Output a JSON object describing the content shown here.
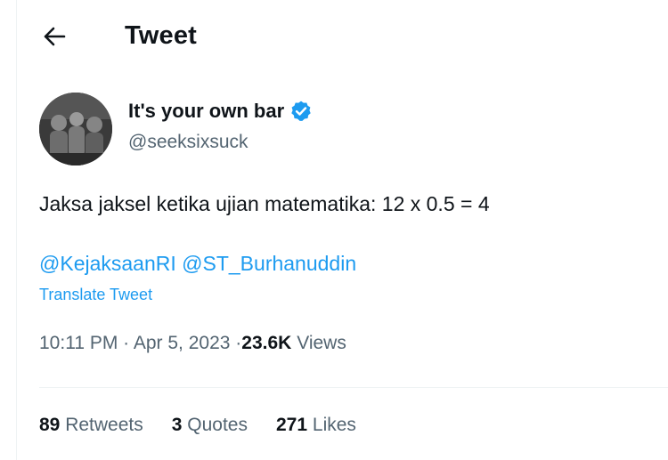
{
  "header": {
    "title": "Tweet",
    "back_icon": "arrow-left-icon"
  },
  "author": {
    "name": "It's your own bar",
    "handle": "@seeksixsuck",
    "verified_color": "#1d9bf0",
    "verified_icon": "verified-badge-icon"
  },
  "tweet": {
    "text": "Jaksa jaksel ketika ujian matematika: 12 x 0.5 = 4",
    "mentions": [
      "@KejaksaanRI",
      "@ST_Burhanuddin"
    ],
    "translate_label": "Translate Tweet",
    "time": "10:11 PM",
    "separator": "·",
    "date": "Apr 5, 2023",
    "views_count": "23.6K",
    "views_label": "Views"
  },
  "stats": {
    "retweets_count": "89",
    "retweets_label": "Retweets",
    "quotes_count": "3",
    "quotes_label": "Quotes",
    "likes_count": "271",
    "likes_label": "Likes"
  },
  "colors": {
    "accent": "#1d9bf0",
    "text_primary": "#0f1419",
    "text_secondary": "#536471",
    "border": "#eff3f4"
  }
}
